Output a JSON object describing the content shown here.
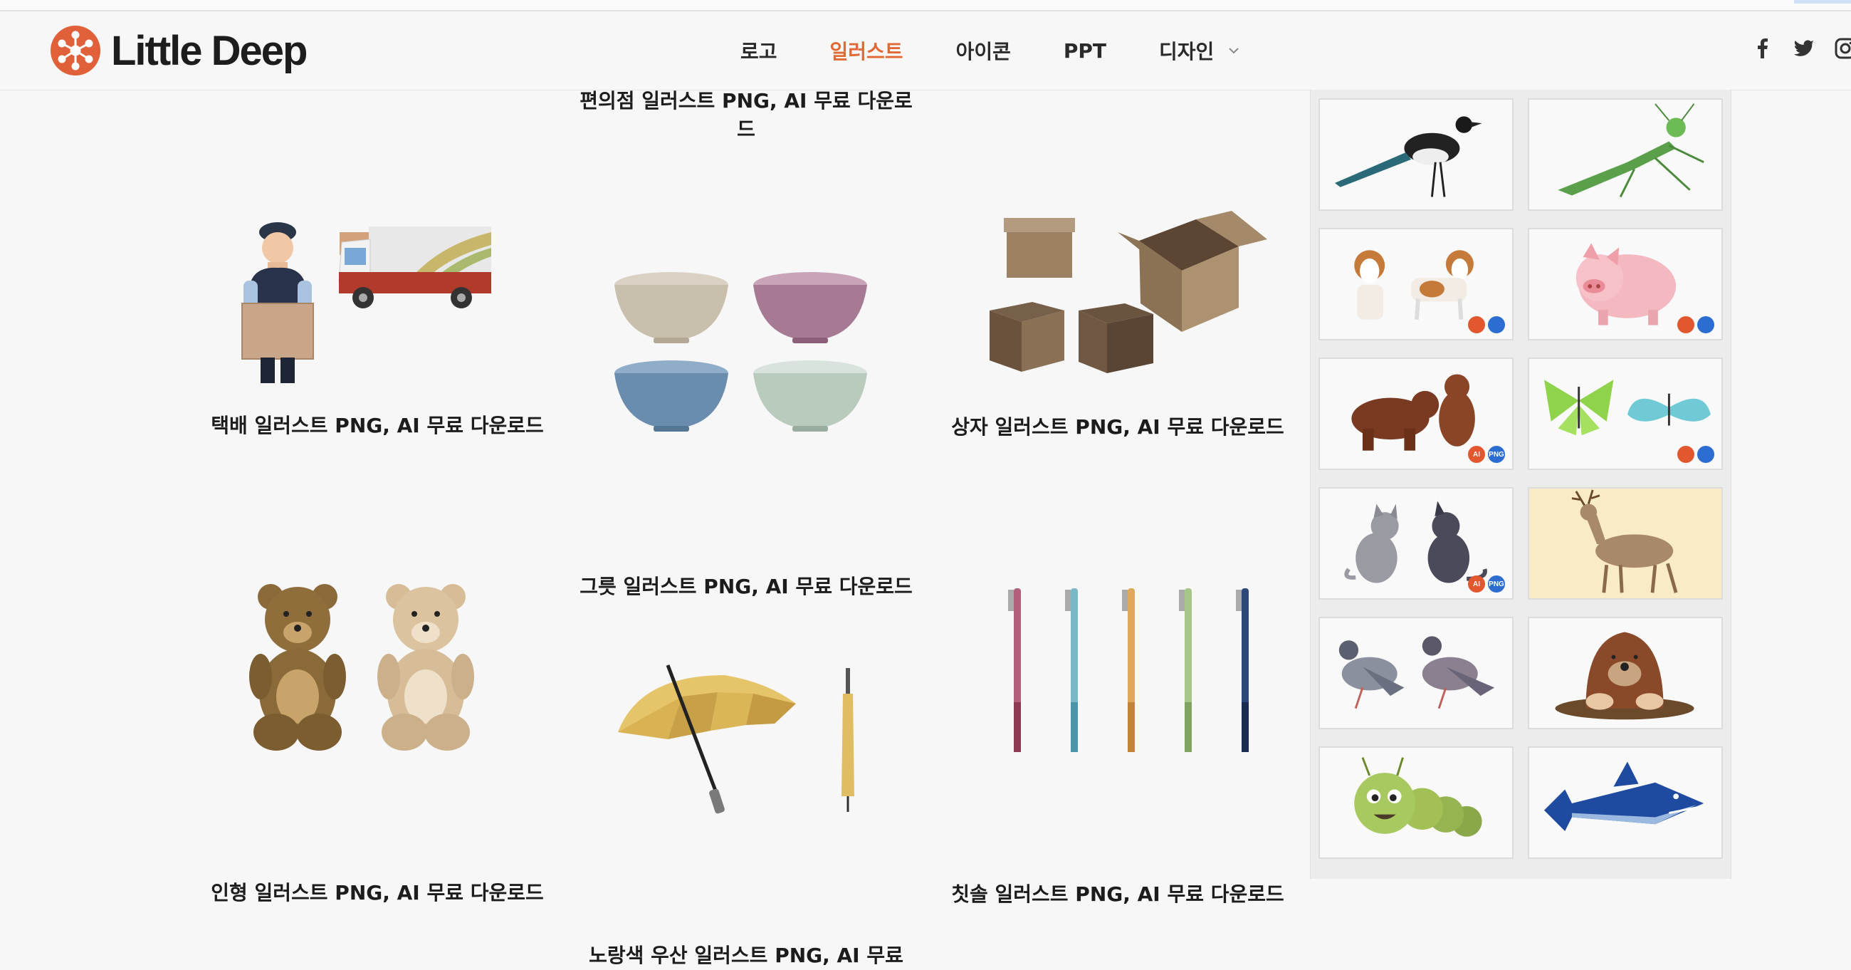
{
  "site": {
    "name": "Little Deep"
  },
  "nav": {
    "items": [
      {
        "label": "로고"
      },
      {
        "label": "일러스트",
        "active": true
      },
      {
        "label": "아이콘"
      },
      {
        "label": "PPT"
      },
      {
        "label": "디자인"
      }
    ]
  },
  "social": [
    "facebook-icon",
    "twitter-icon",
    "instagram-icon"
  ],
  "posts": [
    {
      "title": "편의점 일러스트 PNG, AI 무료 다운로드"
    },
    {
      "title": "택배 일러스트 PNG, AI 무료 다운로드"
    },
    {
      "title": "그릇 일러스트 PNG, AI 무료 다운로드"
    },
    {
      "title": "상자 일러스트 PNG, AI 무료 다운로드"
    },
    {
      "title": "인형 일러스트 PNG, AI 무료 다운로드"
    },
    {
      "title": "노랑색 우산 일러스트 PNG, AI 무료"
    },
    {
      "title": "칫솔 일러스트 PNG, AI 무료 다운로드"
    }
  ],
  "sidebar": {
    "badges": {
      "ai": "AI",
      "png": "PNG"
    },
    "thumbs": [
      "magpie",
      "mantis",
      "dogs",
      "pig",
      "bears",
      "butterflies",
      "cats",
      "deer",
      "pigeons",
      "mole",
      "caterpillar",
      "shark"
    ]
  },
  "colors": {
    "accent": "#e06936",
    "ai_badge": "#e2572e",
    "png_badge": "#2b6dd0"
  }
}
